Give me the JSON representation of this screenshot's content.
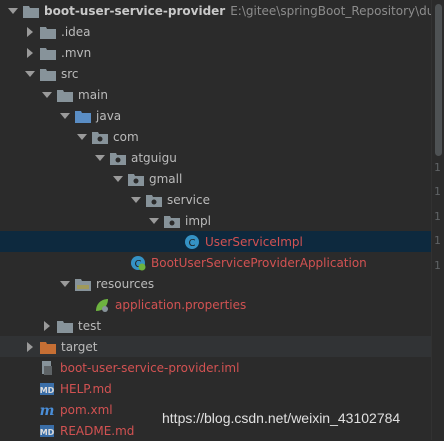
{
  "project": {
    "name": "boot-user-service-provider",
    "path": "E:\\gitee\\springBoot_Repository\\dubbo"
  },
  "tree": {
    "idea": ".idea",
    "mvn": ".mvn",
    "src": "src",
    "main": "main",
    "java": "java",
    "com": "com",
    "atguigu": "atguigu",
    "gmall": "gmall",
    "service": "service",
    "impl": "impl",
    "user_service_impl": "UserServiceImpl",
    "application_class": "BootUserServiceProviderApplication",
    "resources": "resources",
    "application_properties": "application.properties",
    "test": "test",
    "target": "target",
    "iml": "boot-user-service-provider.iml",
    "help": "HELP.md",
    "pom": "pom.xml",
    "readme": "README.md"
  },
  "gutter_digits": [
    "1",
    "1",
    "1",
    "1",
    "1"
  ],
  "watermark": "https://blog.csdn.net/weixin_43102784",
  "colors": {
    "background": "#2b2b2b",
    "selection": "#0d293e",
    "text": "#bbbbbb",
    "error_red": "#d25252",
    "folder": "#87939a",
    "source_folder": "#5a8dc4",
    "resource_folder": "#a09a5a",
    "class_icon": "#3592c4",
    "target_folder": "#c66f34",
    "spring_green": "#6db33f"
  },
  "icons": {
    "folder": "folder-icon",
    "source_folder": "source-folder-icon",
    "package": "package-icon",
    "class": "class-icon",
    "spring_boot_app": "spring-boot-app-icon",
    "properties": "spring-properties-icon",
    "module_file": "iml-file-icon",
    "markdown": "markdown-icon",
    "maven": "maven-icon"
  }
}
